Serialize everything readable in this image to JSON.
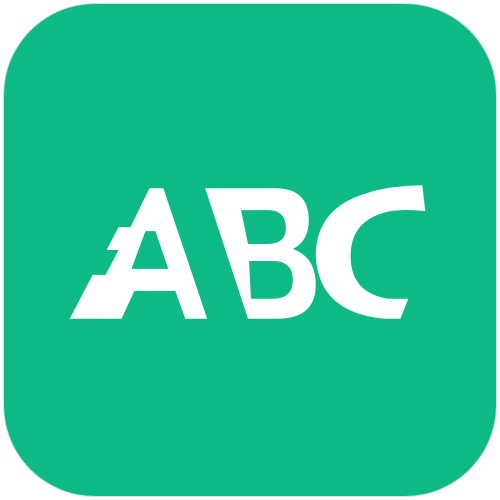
{
  "app_icon": {
    "logo_text": "ABC",
    "colors": {
      "background": "#0dba85",
      "logo": "#ffffff",
      "border": "#d9dcda"
    }
  }
}
